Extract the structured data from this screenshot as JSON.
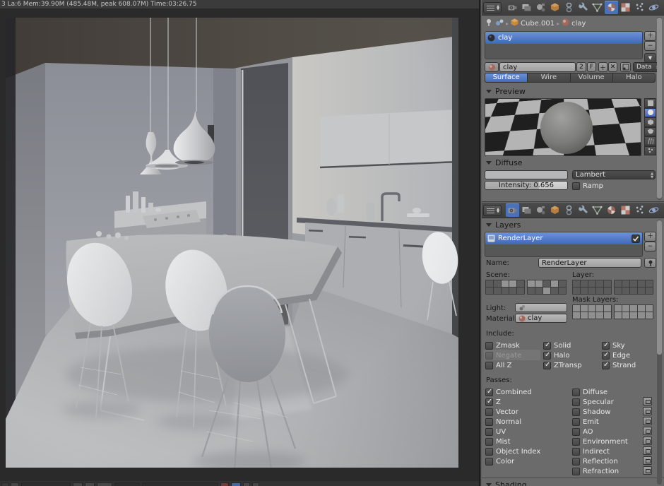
{
  "viewport": {
    "stats": "3 La:6 Mem:39.90M (485.48M, peak 608.07M) Time:03:26.75"
  },
  "tabs": {
    "names": [
      "render",
      "render-layers",
      "scene",
      "object",
      "constraints",
      "modifiers",
      "data",
      "material",
      "texture",
      "particles",
      "physics"
    ],
    "top_selected": "material",
    "bottom_selected": "render"
  },
  "breadcrumb": {
    "object": "Cube.001",
    "material": "clay"
  },
  "material": {
    "slots": [
      {
        "name": "clay"
      }
    ],
    "name": "clay",
    "users": "2",
    "fake_label": "F",
    "link_label": "Data",
    "types": [
      "Surface",
      "Wire",
      "Volume",
      "Halo"
    ],
    "type_selected": "Surface",
    "preview_label": "Preview",
    "diffuse": {
      "label": "Diffuse",
      "shader": "Lambert",
      "intensity": "Intensity: 0.656",
      "intensity_fraction": 0.656,
      "ramp": "Ramp"
    }
  },
  "layers": {
    "label": "Layers",
    "rows": [
      {
        "name": "RenderLayer",
        "enabled": true
      }
    ],
    "name_label": "Name:",
    "name": "RenderLayer",
    "scene_label": "Scene:",
    "layer_label": "Layer:",
    "mask_label": "Mask Layers:",
    "light_label": "Light:",
    "material_label": "Material:",
    "material_value": "clay",
    "scene_grid_a": [
      0,
      0,
      1,
      1,
      0,
      0,
      0,
      0,
      0,
      0
    ],
    "scene_grid_b": [
      1,
      1,
      0,
      1,
      0,
      0,
      0,
      1,
      0,
      0
    ],
    "layer_grid_a": [
      0,
      0,
      0,
      0,
      0,
      0,
      0,
      0,
      0,
      0
    ],
    "layer_grid_b": [
      0,
      0,
      0,
      0,
      0,
      0,
      0,
      0,
      0,
      0
    ],
    "mask_grid_a": [
      0,
      0,
      0,
      0,
      0,
      0,
      0,
      0,
      0,
      0
    ],
    "mask_grid_b": [
      0,
      0,
      0,
      0,
      0,
      0,
      0,
      0,
      0,
      0
    ],
    "include": {
      "label": "Include:",
      "items": [
        {
          "label": "Zmask",
          "checked": false,
          "disabled": false
        },
        {
          "label": "Negate",
          "checked": false,
          "disabled": true
        },
        {
          "label": "All Z",
          "checked": false,
          "disabled": false
        },
        {
          "label": "Solid",
          "checked": true
        },
        {
          "label": "Halo",
          "checked": true
        },
        {
          "label": "ZTransp",
          "checked": true
        },
        {
          "label": "Sky",
          "checked": true
        },
        {
          "label": "Edge",
          "checked": true
        },
        {
          "label": "Strand",
          "checked": true
        }
      ]
    },
    "passes": {
      "label": "Passes:",
      "col1": [
        {
          "label": "Combined",
          "checked": true
        },
        {
          "label": "Z",
          "checked": true
        },
        {
          "label": "Vector",
          "checked": false
        },
        {
          "label": "Normal",
          "checked": false
        },
        {
          "label": "UV",
          "checked": false
        },
        {
          "label": "Mist",
          "checked": false
        },
        {
          "label": "Object Index",
          "checked": false
        },
        {
          "label": "Color",
          "checked": false
        }
      ],
      "col2": [
        {
          "label": "Diffuse",
          "checked": false,
          "btn": false
        },
        {
          "label": "Specular",
          "checked": false,
          "btn": true
        },
        {
          "label": "Shadow",
          "checked": false,
          "btn": true
        },
        {
          "label": "Emit",
          "checked": false,
          "btn": true
        },
        {
          "label": "AO",
          "checked": false,
          "btn": true
        },
        {
          "label": "Environment",
          "checked": false,
          "btn": true
        },
        {
          "label": "Indirect",
          "checked": false,
          "btn": true
        },
        {
          "label": "Reflection",
          "checked": false,
          "btn": true
        },
        {
          "label": "Refraction",
          "checked": false,
          "btn": true
        }
      ]
    }
  },
  "shading": {
    "label": "Shading"
  }
}
